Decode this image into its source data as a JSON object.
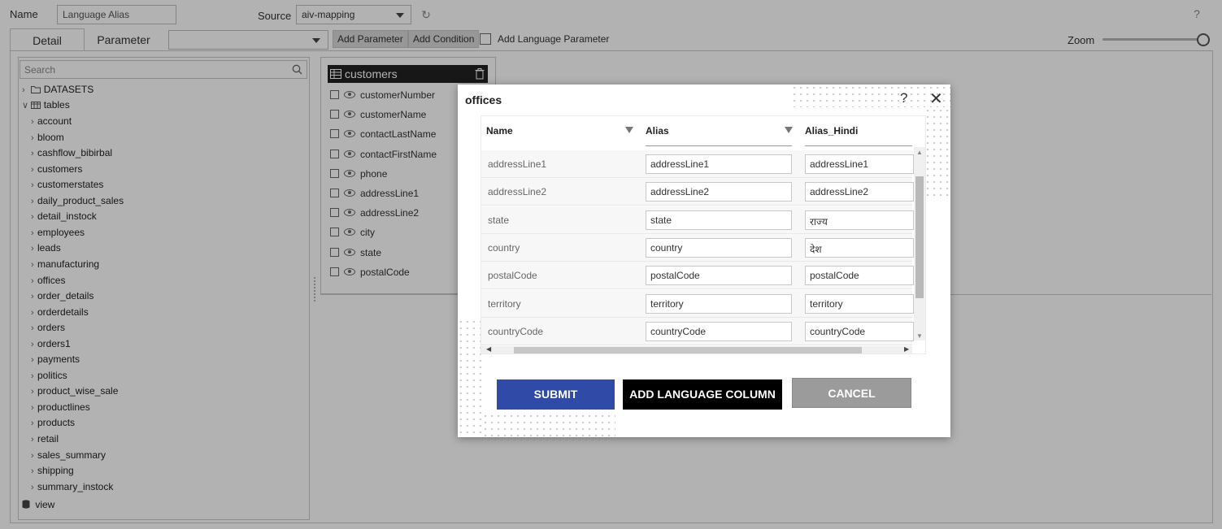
{
  "header": {
    "name_label": "Name",
    "name_value": "Language Alias",
    "source_label": "Source",
    "source_value": "aiv-mapping",
    "help_symbol": "?"
  },
  "tabs": [
    {
      "label": "Detail"
    },
    {
      "label": "Parameter"
    }
  ],
  "toolbar": {
    "parameter_select_value": "",
    "add_parameter": "Add Parameter",
    "add_condition": "Add Condition",
    "add_language_parameter": "Add Language Parameter",
    "zoom_label": "Zoom",
    "zoom_level": 1.0
  },
  "tree": {
    "search_placeholder": "Search",
    "datasets_label": "DATASETS",
    "tables_label": "tables",
    "view_label": "view",
    "tables": [
      "account",
      "bloom",
      "cashflow_bibirbal",
      "customers",
      "customerstates",
      "daily_product_sales",
      "detail_instock",
      "employees",
      "leads",
      "manufacturing",
      "offices",
      "order_details",
      "orderdetails",
      "orders",
      "orders1",
      "payments",
      "politics",
      "product_wise_sale",
      "productlines",
      "products",
      "retail",
      "sales_summary",
      "shipping",
      "summary_instock"
    ]
  },
  "table_card": {
    "title": "customers",
    "fields": [
      "customerNumber",
      "customerName",
      "contactLastName",
      "contactFirstName",
      "phone",
      "addressLine1",
      "addressLine2",
      "city",
      "state",
      "postalCode"
    ]
  },
  "modal": {
    "title": "offices",
    "help_symbol": "?",
    "close_symbol": "✕",
    "columns": [
      "Name",
      "Alias",
      "Alias_Hindi"
    ],
    "rows": [
      {
        "name": "addressLine1",
        "alias": "addressLine1",
        "alias_hindi": "addressLine1"
      },
      {
        "name": "addressLine2",
        "alias": "addressLine2",
        "alias_hindi": "addressLine2"
      },
      {
        "name": "state",
        "alias": "state",
        "alias_hindi": "राज्य"
      },
      {
        "name": "country",
        "alias": "country",
        "alias_hindi": "देश"
      },
      {
        "name": "postalCode",
        "alias": "postalCode",
        "alias_hindi": "postalCode"
      },
      {
        "name": "territory",
        "alias": "territory",
        "alias_hindi": "territory"
      },
      {
        "name": "countryCode",
        "alias": "countryCode",
        "alias_hindi": "countryCode"
      }
    ],
    "submit": "SUBMIT",
    "add_language_column": "ADD LANGUAGE COLUMN",
    "cancel": "CANCEL"
  },
  "colors": {
    "submit": "#2f4aa7",
    "add_language_column": "#000000",
    "cancel": "#9b9b9b",
    "card_header": "#222222"
  }
}
